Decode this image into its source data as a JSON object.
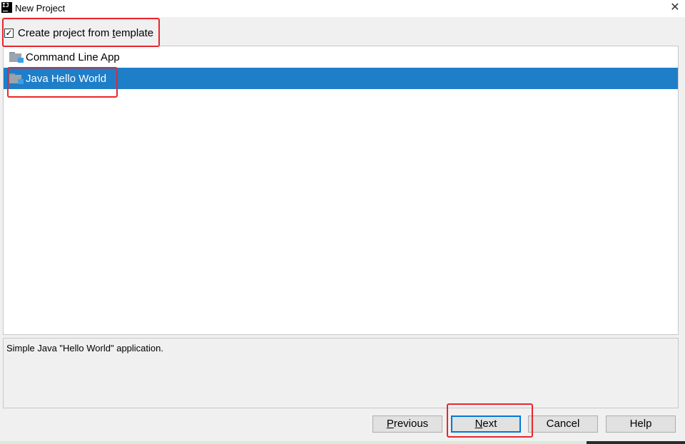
{
  "window": {
    "title": "New Project",
    "app_icon_text": "IJ",
    "close_glyph": "✕"
  },
  "template_option": {
    "checked": true,
    "check_glyph": "✓",
    "label_pre": "Create project from ",
    "label_mnemonic": "t",
    "label_post": "emplate"
  },
  "templates": [
    {
      "label": "Command Line App",
      "icon": "folder-module-icon",
      "selected": false
    },
    {
      "label": "Java Hello World",
      "icon": "folder-module-icon",
      "selected": true
    }
  ],
  "description": "Simple Java \"Hello World\" application.",
  "buttons": {
    "previous": {
      "mnemonic": "P",
      "rest": "revious"
    },
    "next": {
      "mnemonic": "N",
      "rest": "ext"
    },
    "cancel": "Cancel",
    "help": "Help"
  },
  "colors": {
    "selection": "#1e7ec8",
    "highlight_annotation": "#e8262d",
    "default_button_border": "#0078d7"
  }
}
